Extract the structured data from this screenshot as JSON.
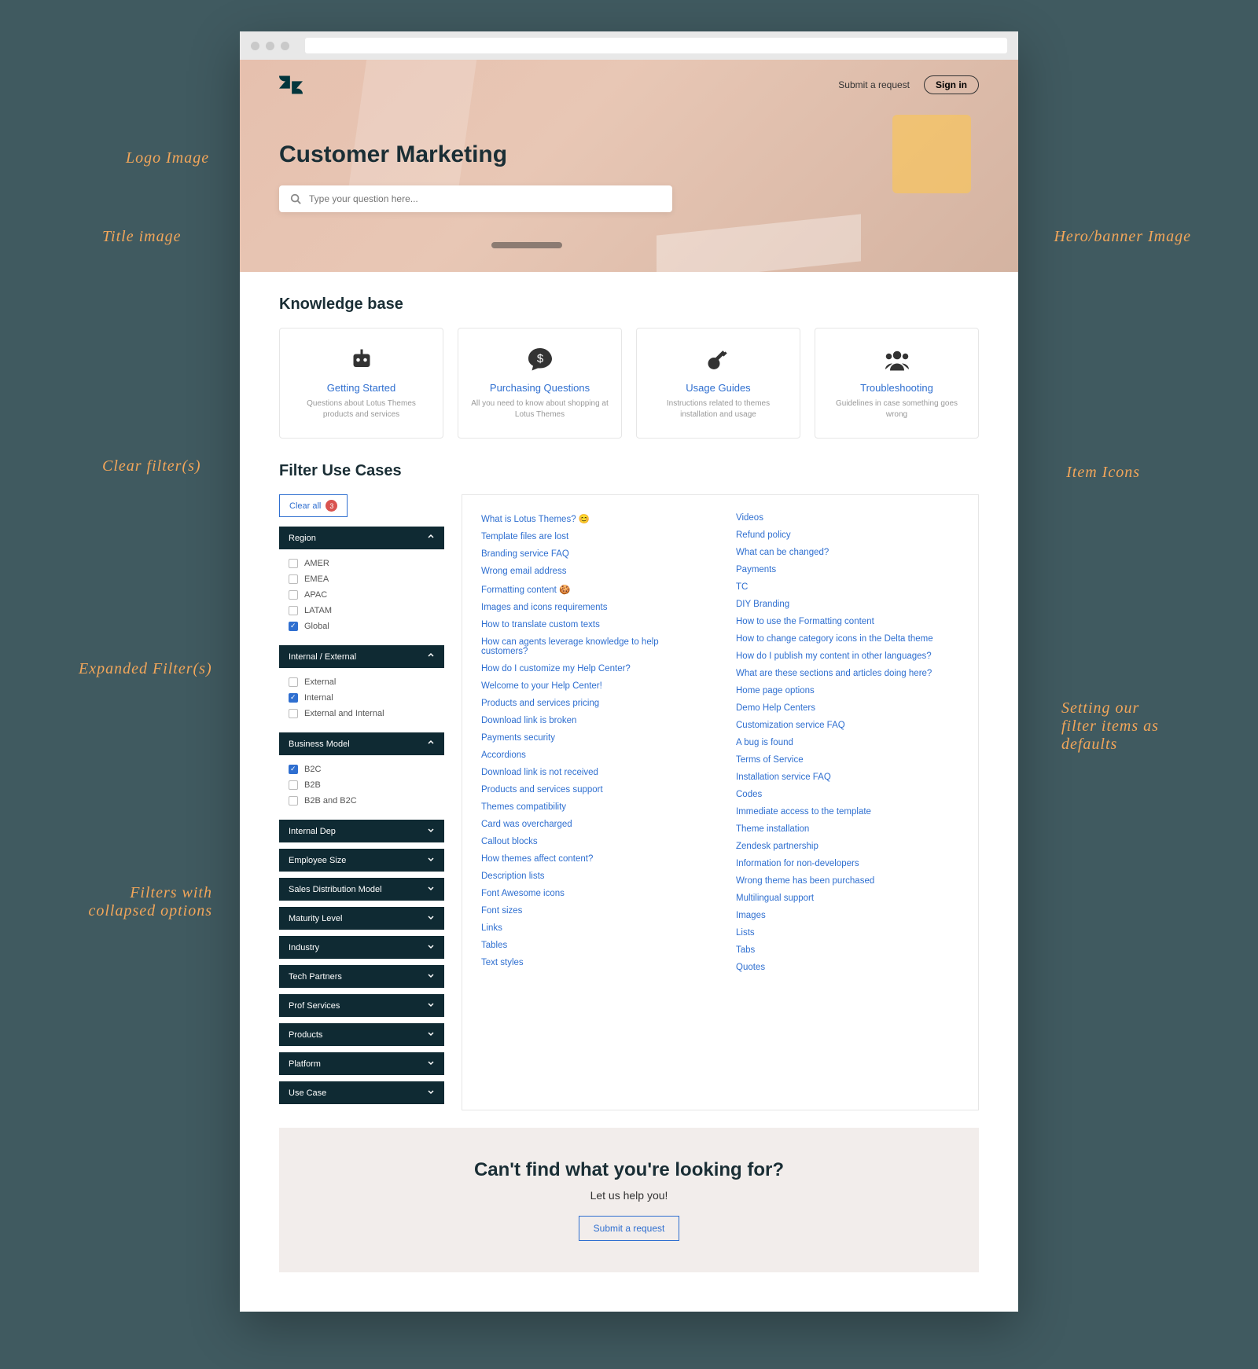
{
  "header": {
    "submit_label": "Submit a request",
    "signin_label": "Sign in",
    "page_title": "Customer Marketing",
    "search_placeholder": "Type your question here..."
  },
  "kb": {
    "heading": "Knowledge base",
    "cards": [
      {
        "icon": "robot-icon",
        "title": "Getting Started",
        "desc": "Questions about Lotus Themes products and services"
      },
      {
        "icon": "chat-dollar-icon",
        "title": "Purchasing Questions",
        "desc": "All you need to know about shopping at Lotus Themes"
      },
      {
        "icon": "key-icon",
        "title": "Usage Guides",
        "desc": "Instructions related to themes installation and usage"
      },
      {
        "icon": "users-icon",
        "title": "Troubleshooting",
        "desc": "Guidelines in case something goes wrong"
      }
    ]
  },
  "filters": {
    "heading": "Filter Use Cases",
    "clear_label": "Clear all",
    "clear_count": "3",
    "groups": [
      {
        "name": "Region",
        "expanded": true,
        "options": [
          {
            "label": "AMER",
            "checked": false
          },
          {
            "label": "EMEA",
            "checked": false
          },
          {
            "label": "APAC",
            "checked": false
          },
          {
            "label": "LATAM",
            "checked": false
          },
          {
            "label": "Global",
            "checked": true
          }
        ]
      },
      {
        "name": "Internal / External",
        "expanded": true,
        "options": [
          {
            "label": "External",
            "checked": false
          },
          {
            "label": "Internal",
            "checked": true
          },
          {
            "label": "External and Internal",
            "checked": false
          }
        ]
      },
      {
        "name": "Business Model",
        "expanded": true,
        "options": [
          {
            "label": "B2C",
            "checked": true
          },
          {
            "label": "B2B",
            "checked": false
          },
          {
            "label": "B2B and B2C",
            "checked": false
          }
        ]
      },
      {
        "name": "Internal Dep",
        "expanded": false,
        "options": []
      },
      {
        "name": "Employee Size",
        "expanded": false,
        "options": []
      },
      {
        "name": "Sales Distribution Model",
        "expanded": false,
        "options": []
      },
      {
        "name": "Maturity Level",
        "expanded": false,
        "options": []
      },
      {
        "name": "Industry",
        "expanded": false,
        "options": []
      },
      {
        "name": "Tech Partners",
        "expanded": false,
        "options": []
      },
      {
        "name": "Prof Services",
        "expanded": false,
        "options": []
      },
      {
        "name": "Products",
        "expanded": false,
        "options": []
      },
      {
        "name": "Platform",
        "expanded": false,
        "options": []
      },
      {
        "name": "Use Case",
        "expanded": false,
        "options": []
      }
    ]
  },
  "articles": [
    "What is Lotus Themes? 😊",
    "Template files are lost",
    "Branding service FAQ",
    "Wrong email address",
    "Formatting content 🍪",
    "Images and icons requirements",
    "How to translate custom texts",
    "How can agents leverage knowledge to help customers?",
    "How do I customize my Help Center?",
    "Welcome to your Help Center!",
    "Products and services pricing",
    "Download link is broken",
    "Payments security",
    "Accordions",
    "Download link is not received",
    "Products and services support",
    "Themes compatibility",
    "Card was overcharged",
    "Callout blocks",
    "How themes affect content?",
    "Description lists",
    "Font Awesome icons",
    "Font sizes",
    "Links",
    "Tables",
    "Text styles",
    "Videos",
    "Refund policy",
    "What can be changed?",
    "Payments",
    "TC",
    "DIY Branding",
    "How to use the Formatting content",
    "How to change category icons in the Delta theme",
    "How do I publish my content in other languages?",
    "What are these sections and articles doing here?",
    "Home page options",
    "Demo Help Centers",
    "Customization service FAQ",
    "A bug is found",
    "Terms of Service",
    "Installation service FAQ",
    "Codes",
    "Immediate access to the template",
    "Theme installation",
    "Zendesk partnership",
    "Information for non-developers",
    "Wrong theme has been purchased",
    "Multilingual support",
    "Images",
    "Lists",
    "Tabs",
    "Quotes"
  ],
  "cta": {
    "title": "Can't find what you're looking for?",
    "sub": "Let us help you!",
    "btn": "Submit a request"
  },
  "callouts": {
    "logo": "Logo Image",
    "title": "Title image",
    "hero": "Hero/banner Image",
    "clear": "Clear filter(s)",
    "expanded": "Expanded Filter(s)",
    "icon": "Item Icons",
    "collapsed": "Filters with collapsed options",
    "defaults": "Setting our filter items as defaults"
  }
}
